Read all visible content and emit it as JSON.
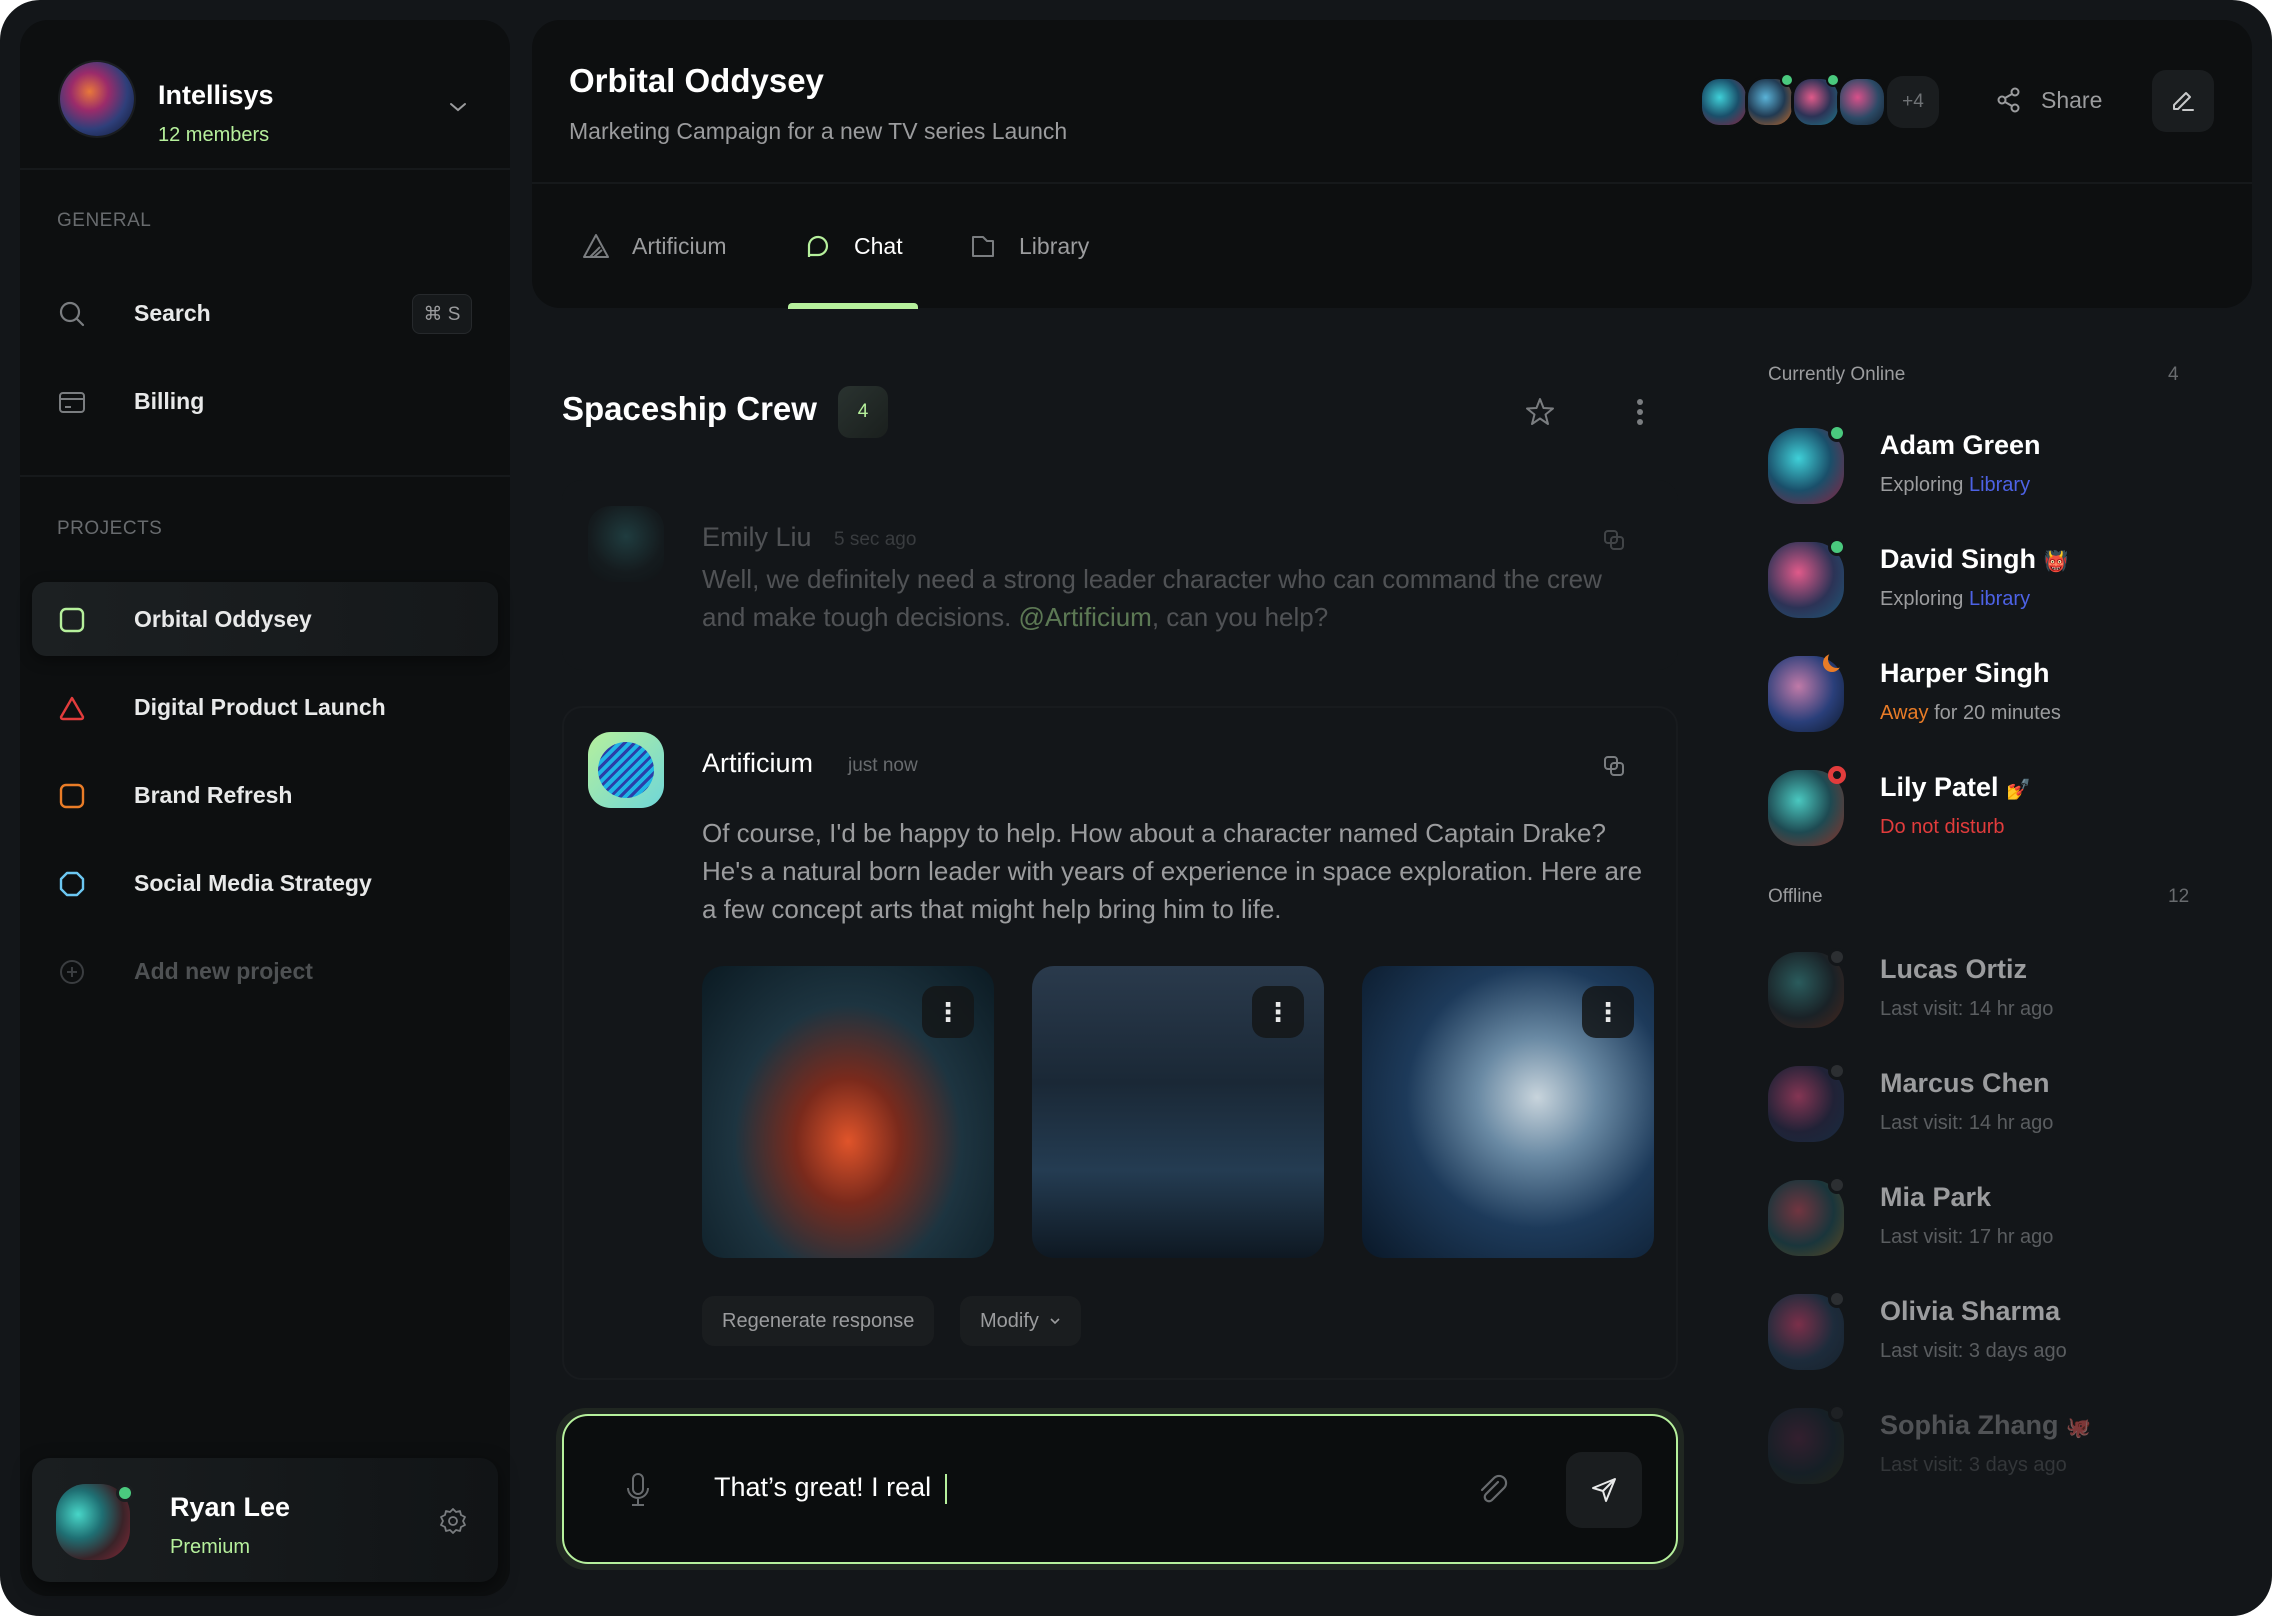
{
  "workspace": {
    "name": "Intellisys",
    "members": "12 members"
  },
  "general": {
    "label": "GENERAL",
    "items": [
      {
        "label": "Search",
        "icon": "search-icon",
        "shortcut": "⌘ S"
      },
      {
        "label": "Billing",
        "icon": "credit-card-icon"
      }
    ]
  },
  "projects": {
    "label": "PROJECTS",
    "items": [
      {
        "label": "Orbital Oddysey",
        "icon": "square-icon",
        "color": "#b6f09c",
        "active": true
      },
      {
        "label": "Digital Product Launch",
        "icon": "triangle-icon",
        "color": "#e23c3c"
      },
      {
        "label": "Brand Refresh",
        "icon": "square-icon",
        "color": "#e97c27"
      },
      {
        "label": "Social Media Strategy",
        "icon": "octagon-icon",
        "color": "#6cc7f2"
      }
    ],
    "add_label": "Add new project"
  },
  "current_user": {
    "name": "Ryan Lee",
    "plan": "Premium",
    "status_color": "#4ac97e"
  },
  "header": {
    "title": "Orbital Oddysey",
    "subtitle": "Marketing Campaign for a new TV series Launch",
    "more_members": "+4",
    "share_label": "Share"
  },
  "tabs": [
    {
      "label": "Artificium",
      "icon": "artificium-logo-icon"
    },
    {
      "label": "Chat",
      "icon": "chat-bubble-icon",
      "active": true
    },
    {
      "label": "Library",
      "icon": "folder-icon"
    }
  ],
  "chat": {
    "title": "Spaceship Crew",
    "member_count": "4",
    "messages": [
      {
        "author": "Emily Liu",
        "time": "5 sec ago",
        "text_before": "Well, we definitely need a strong leader character who can command the crew and make tough decisions. ",
        "mention": "@Artificium",
        "text_after": ", can you help?"
      },
      {
        "author": "Artificium",
        "time": "just now",
        "text": "Of course, I'd be happy to help. How about a character named Captain Drake? He's a natural born leader with years of experience in space exploration. Here are a few concept arts that might help bring him to life.",
        "images": [
          "spaceship-corridor-astronaut",
          "control-room-crew",
          "astronaut-helmet-portrait"
        ],
        "actions": {
          "regenerate": "Regenerate response",
          "modify": "Modify"
        }
      }
    ],
    "input_value": "That’s great! I real "
  },
  "online": {
    "label": "Currently Online",
    "count": "4",
    "members": [
      {
        "name": "Adam Green",
        "status_prefix": "Exploring",
        "status_link": "Library",
        "dot": "#4ac97e"
      },
      {
        "name": "David Singh",
        "emoji": "👹",
        "status_prefix": "Exploring",
        "status_link": "Library",
        "dot": "#4ac97e"
      },
      {
        "name": "Harper Singh",
        "status_away": "Away",
        "status_rest": "for 20 minutes",
        "dot": "#e97c27"
      },
      {
        "name": "Lily Patel",
        "emoji": "💅",
        "status_dnd": "Do not disturb",
        "dot": "#e23c3c"
      }
    ]
  },
  "offline": {
    "label": "Offline",
    "count": "12",
    "members": [
      {
        "name": "Lucas Ortiz",
        "status": "Last visit: 14 hr ago"
      },
      {
        "name": "Marcus Chen",
        "status": "Last visit: 14 hr ago"
      },
      {
        "name": "Mia Park",
        "status": "Last visit: 17 hr ago"
      },
      {
        "name": "Olivia Sharma",
        "status": "Last visit: 3 days ago"
      },
      {
        "name": "Sophia Zhang",
        "emoji": "🐙",
        "status": "Last visit: 3 days ago"
      }
    ]
  },
  "colors": {
    "accent": "#b6f09c",
    "link": "#4d62e5",
    "away": "#e97c27",
    "dnd": "#e23c3c",
    "online": "#4ac97e"
  }
}
